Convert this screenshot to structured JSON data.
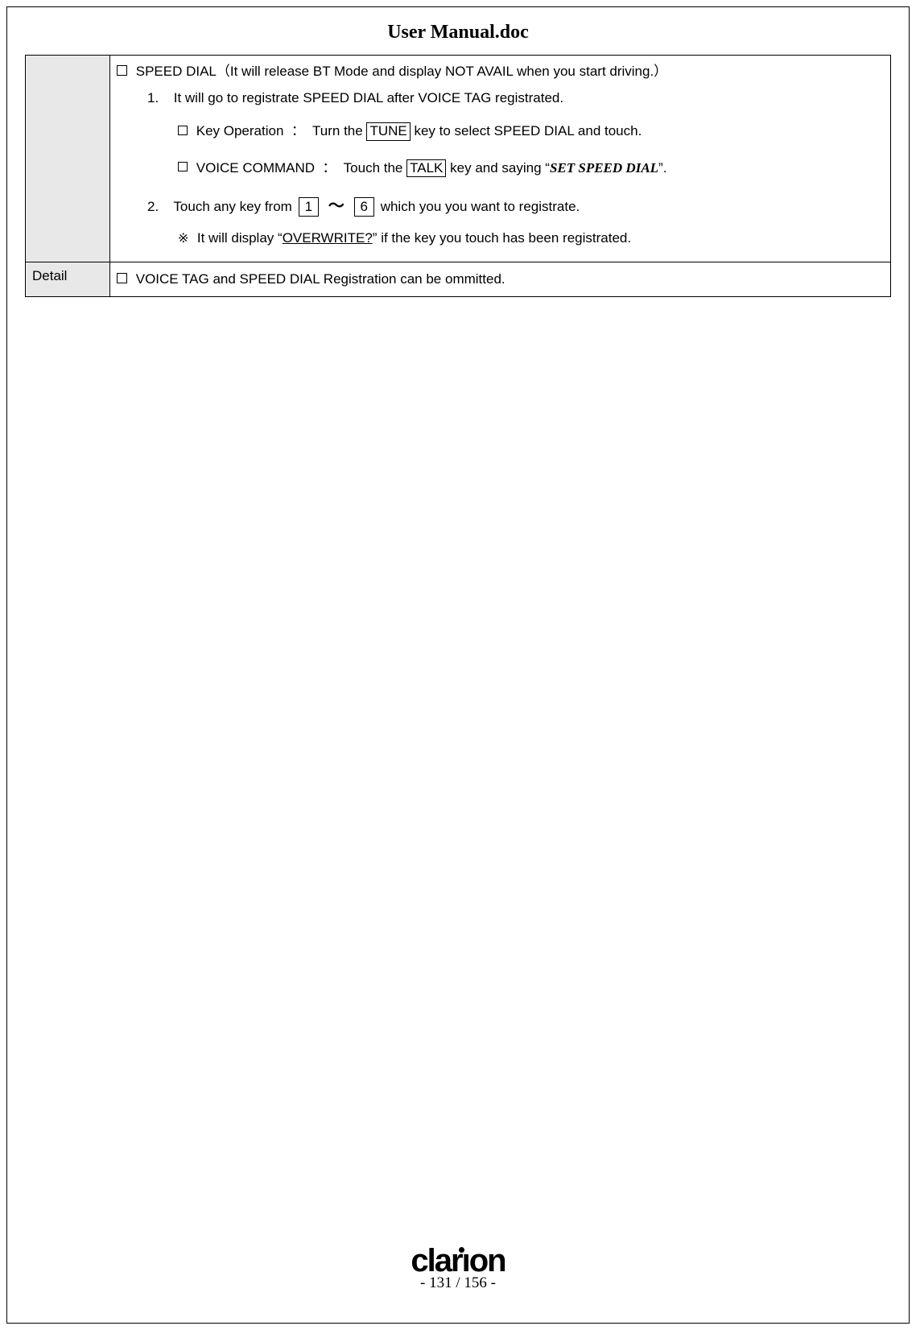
{
  "header": {
    "title": "User Manual.doc"
  },
  "table": {
    "row1": {
      "left_label": "",
      "main_title": "SPEED DIAL（It will release BT Mode and display NOT AVAIL when you start driving.）",
      "item1_num": "1.",
      "item1_text": "It will go to registrate SPEED DIAL after VOICE TAG registrated.",
      "key_op_label": "Key Operation",
      "key_op_sep": "：",
      "key_op_prefix": "Turn the",
      "key_op_key": "TUNE",
      "key_op_suffix": "key to select SPEED DIAL and touch.",
      "voice_cmd_label": "VOICE COMMAND",
      "voice_cmd_sep": "：",
      "voice_cmd_prefix": "Touch the",
      "voice_cmd_key": "TALK",
      "voice_cmd_mid": "key and saying",
      "voice_cmd_phrase": "SET SPEED DIAL",
      "item2_num": "2.",
      "item2_prefix": "Touch any key from",
      "item2_key1": "1",
      "item2_tilde": "～",
      "item2_key2": "6",
      "item2_suffix": "which you you want to registrate.",
      "note_mark": "※",
      "note_prefix": "It will display",
      "note_highlight": "OVERWRITE?",
      "note_suffix": "if the key you touch has been registrated."
    },
    "row2": {
      "left_label": "Detail",
      "text": "VOICE TAG and SPEED DIAL Registration can be ommitted."
    }
  },
  "footer": {
    "logo_text": "clarion",
    "page_prefix": "-",
    "page_current": "131",
    "page_sep": "/",
    "page_total": "156",
    "page_suffix": "-"
  }
}
